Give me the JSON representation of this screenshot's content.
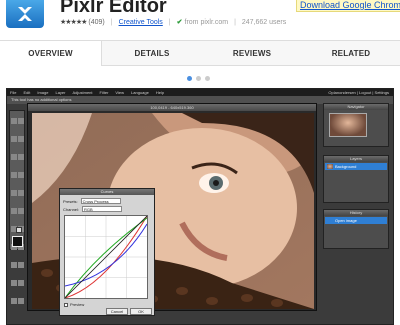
{
  "header": {
    "app_title": "Pixlr Editor",
    "rating_count": "(409)",
    "category_link": "Creative Tools",
    "source": "from pixlr.com",
    "users": "247,662 users",
    "download_link": "Download Google Chrome"
  },
  "tabs": [
    {
      "label": "OVERVIEW",
      "active": true
    },
    {
      "label": "DETAILS",
      "active": false
    },
    {
      "label": "REVIEWS",
      "active": false
    },
    {
      "label": "RELATED",
      "active": false
    }
  ],
  "carousel": {
    "count": 3,
    "active_index": 0
  },
  "screenshot": {
    "menu": [
      "File",
      "Edit",
      "Image",
      "Layer",
      "Adjustment",
      "Filter",
      "View",
      "Language",
      "Help"
    ],
    "menu_right": "Oplanondersen | Logout | Settings",
    "options_text": "This tool has no additional options",
    "doc_title": "100,0419 - 640x519.360",
    "curves": {
      "title": "Curves",
      "presets_label": "Presets:",
      "presets_value": "Cross Process",
      "channel_label": "Channel:",
      "channel_value": "RGB",
      "preview_label": "Preview",
      "cancel_label": "Cancel",
      "ok_label": "OK"
    },
    "navigator_title": "Navigator",
    "layers_title": "Layers",
    "layer_name": "Background",
    "history_title": "History",
    "history_item": "Open image"
  }
}
